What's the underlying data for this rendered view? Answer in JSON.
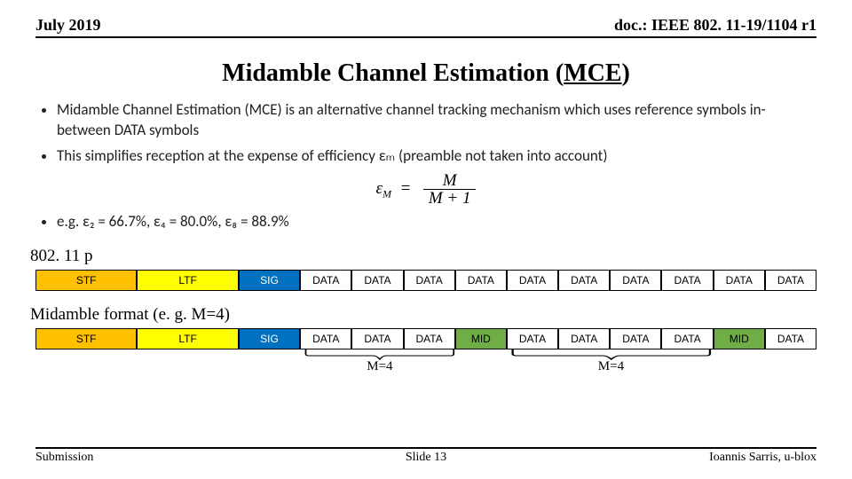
{
  "header": {
    "left": "July 2019",
    "right": "doc.: IEEE 802. 11-19/1104 r1"
  },
  "title": {
    "pre": "Midamble Channel Estimation (",
    "u": "MCE",
    "post": ")"
  },
  "bul": [
    "Midamble Channel Estimation (MCE) is an alternative channel tracking mechanism which uses reference symbols in-between DATA symbols",
    "This simplifies reception at the expense of efficiency εₘ  (preamble not taken into account)",
    "e.g.  ε₂ = 66.7%,  ε₄ = 80.0%,  ε₈ = 88.9%"
  ],
  "eq": {
    "lhs_sym": "ε",
    "lhs_sub": "M",
    "num": "M",
    "den": "M + 1"
  },
  "sec1": "802. 11 p",
  "row1": [
    "STF",
    "LTF",
    "SIG",
    "DATA",
    "DATA",
    "DATA",
    "DATA",
    "DATA",
    "DATA",
    "DATA",
    "DATA",
    "DATA",
    "DATA"
  ],
  "sec2": "Midamble format (e. g. M=4)",
  "row2": [
    "STF",
    "LTF",
    "SIG",
    "DATA",
    "DATA",
    "DATA",
    "MID",
    "DATA",
    "DATA",
    "DATA",
    "DATA",
    "MID",
    "DATA"
  ],
  "brlabel": "M=4",
  "footer": {
    "left": "Submission",
    "center": "Slide 13",
    "right": "Ioannis Sarris, u-blox"
  }
}
